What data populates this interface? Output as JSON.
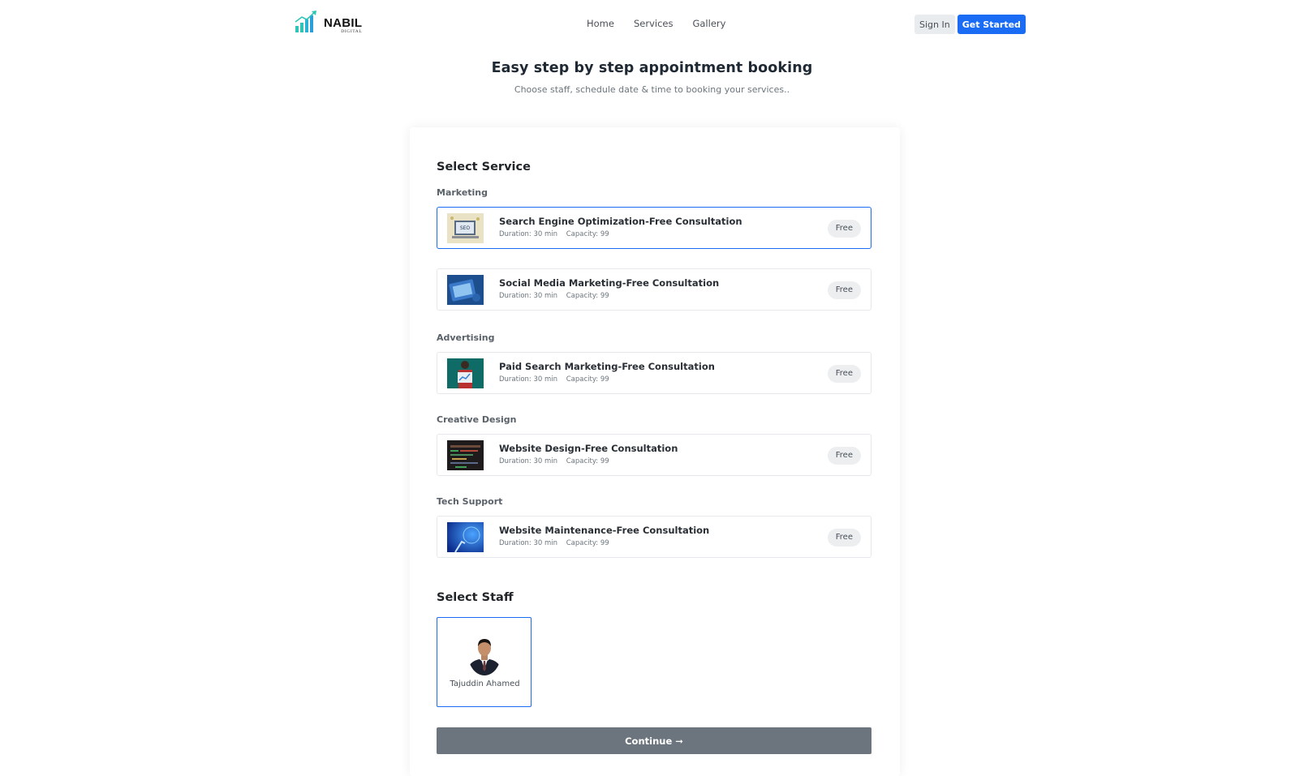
{
  "brand": {
    "name": "NABIL",
    "sub": "DIGITAL",
    "accent": "#2ec4b6"
  },
  "nav": {
    "items": [
      "Home",
      "Services",
      "Gallery"
    ]
  },
  "auth": {
    "signin_label": "Sign In",
    "started_label": "Get Started"
  },
  "hero": {
    "title": "Easy step by step appointment booking",
    "subtitle": "Choose staff, schedule date & time to booking your services.."
  },
  "services_section": {
    "title": "Select Service",
    "categories": [
      {
        "name": "Marketing",
        "services": [
          {
            "name": "Search Engine Optimization-Free Consultation",
            "duration": "Duration: 30 min",
            "capacity": "Capacity: 99",
            "price": "Free",
            "selected": true,
            "thumb": "seo-thumbnail"
          },
          {
            "name": "Social Media Marketing-Free Consultation",
            "duration": "Duration: 30 min",
            "capacity": "Capacity: 99",
            "price": "Free",
            "selected": false,
            "thumb": "social-thumbnail"
          }
        ]
      },
      {
        "name": "Advertising",
        "services": [
          {
            "name": "Paid Search Marketing-Free Consultation",
            "duration": "Duration: 30 min",
            "capacity": "Capacity: 99",
            "price": "Free",
            "selected": false,
            "thumb": "ppc-thumbnail"
          }
        ]
      },
      {
        "name": "Creative Design",
        "services": [
          {
            "name": "Website Design-Free Consultation",
            "duration": "Duration: 30 min",
            "capacity": "Capacity: 99",
            "price": "Free",
            "selected": false,
            "thumb": "design-thumbnail"
          }
        ]
      },
      {
        "name": "Tech Support",
        "services": [
          {
            "name": "Website Maintenance-Free Consultation",
            "duration": "Duration: 30 min",
            "capacity": "Capacity: 99",
            "price": "Free",
            "selected": false,
            "thumb": "maintenance-thumbnail"
          }
        ]
      }
    ]
  },
  "staff_section": {
    "title": "Select Staff",
    "staff": [
      {
        "name": "Tajuddin Ahamed",
        "selected": true
      }
    ]
  },
  "continue_label": "Continue ➞",
  "colors": {
    "primary": "#1a6cf5",
    "continue_bg": "#6c757d",
    "badge_bg": "#eceef0"
  }
}
